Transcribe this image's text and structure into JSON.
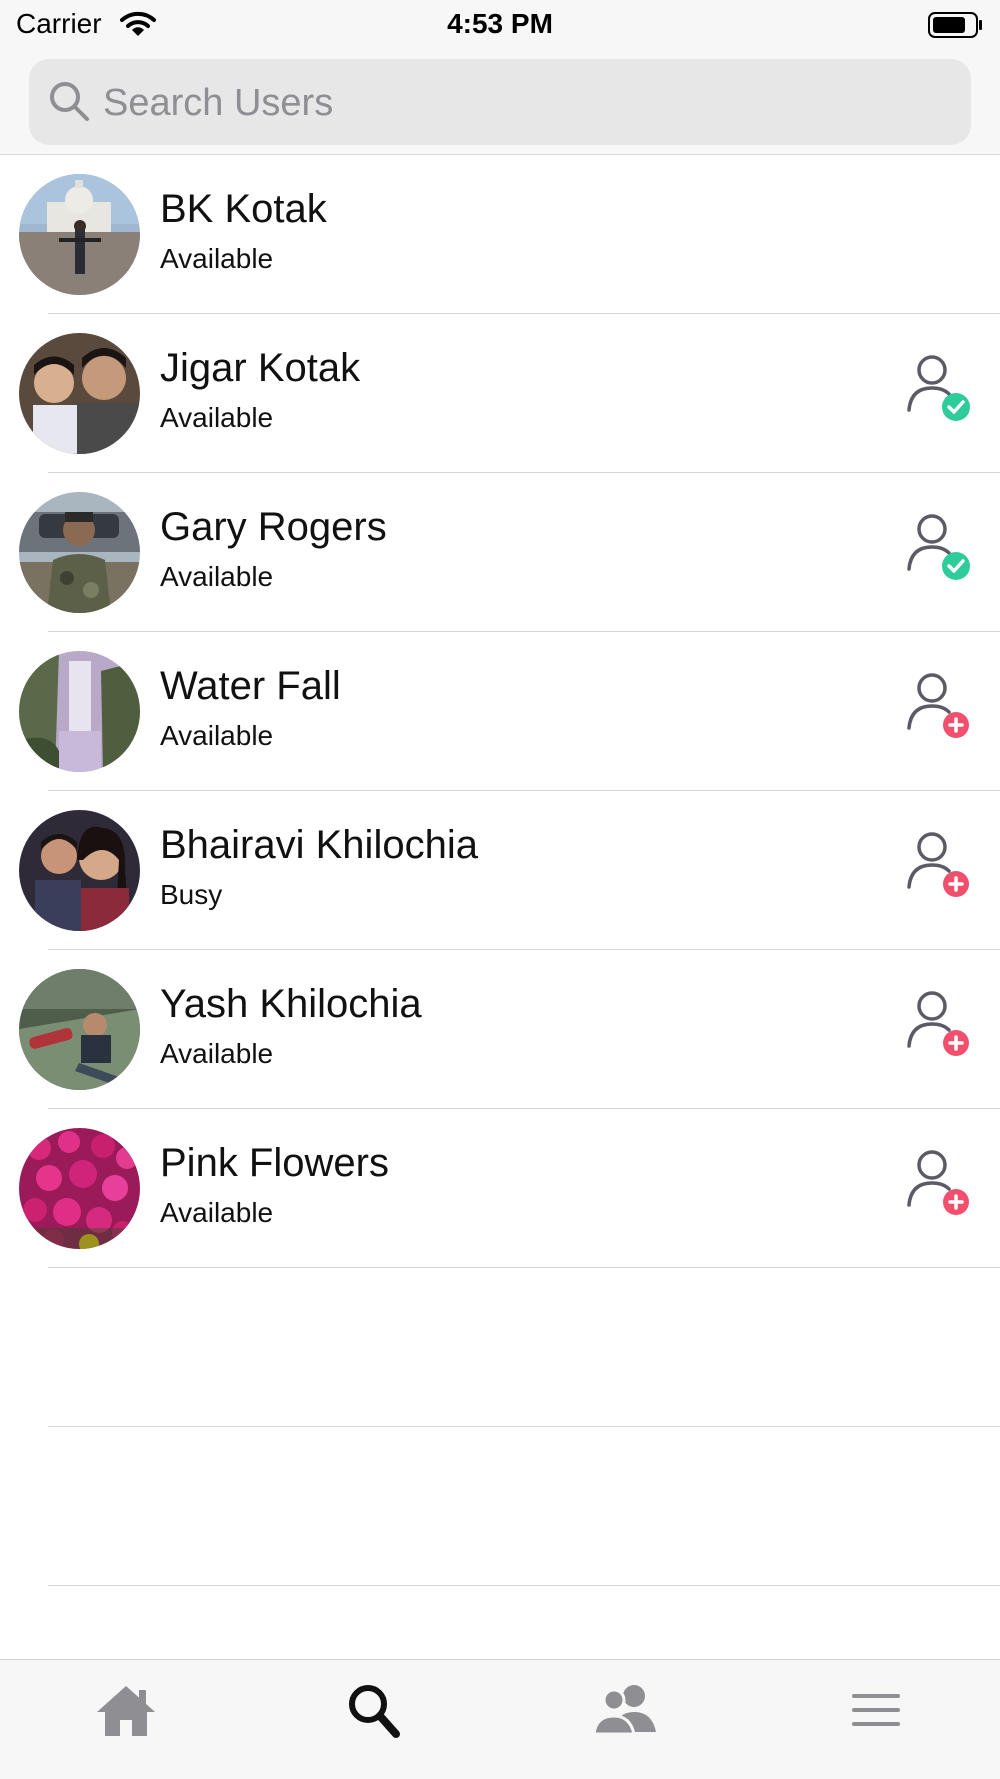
{
  "status_bar": {
    "carrier": "Carrier",
    "time": "4:53 PM"
  },
  "search": {
    "placeholder": "Search Users",
    "value": ""
  },
  "users": [
    {
      "name": "BK Kotak",
      "status": "Available",
      "action": "none"
    },
    {
      "name": "Jigar Kotak",
      "status": "Available",
      "action": "friend-added-icon"
    },
    {
      "name": "Gary Rogers",
      "status": "Available",
      "action": "friend-added-icon"
    },
    {
      "name": "Water Fall",
      "status": "Available",
      "action": "add-friend-icon"
    },
    {
      "name": "Bhairavi Khilochia",
      "status": "Busy",
      "action": "add-friend-icon"
    },
    {
      "name": "Yash Khilochia",
      "status": "Available",
      "action": "add-friend-icon"
    },
    {
      "name": "Pink Flowers",
      "status": "Available",
      "action": "add-friend-icon"
    }
  ],
  "tabs": [
    {
      "icon": "home-icon",
      "selected": false
    },
    {
      "icon": "search-icon",
      "selected": true
    },
    {
      "icon": "contacts-icon",
      "selected": false
    },
    {
      "icon": "menu-icon",
      "selected": false
    }
  ],
  "colors": {
    "added_badge": "#2ecc9a",
    "add_badge": "#f0506e",
    "tab_inactive": "#8e8e93",
    "tab_active": "#111111"
  }
}
